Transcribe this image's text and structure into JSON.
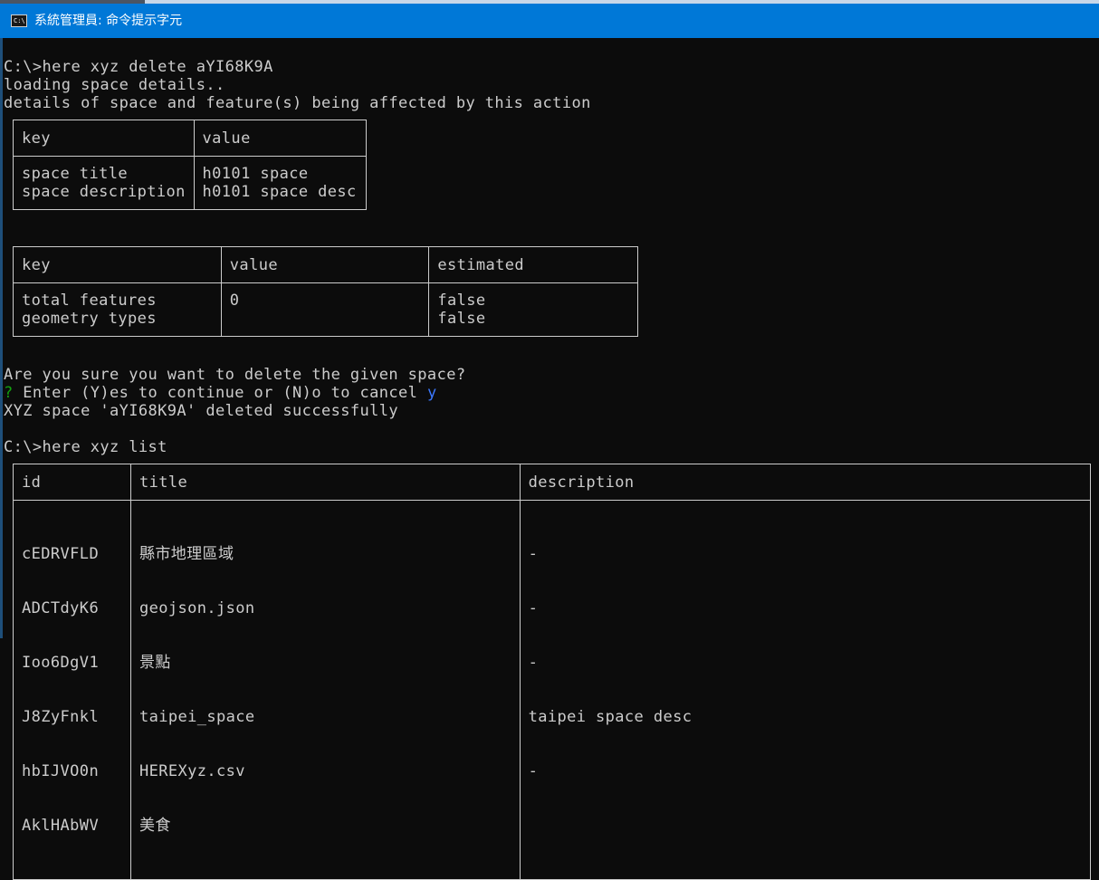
{
  "window": {
    "title": "系統管理員: 命令提示字元",
    "icon": "cmd-icon",
    "icon_text": "C:\\"
  },
  "colors": {
    "background": "#0c0c0c",
    "text": "#cccccc",
    "titlebar": "#0078d7",
    "prompt_mark": "#13a10e",
    "answer": "#3b78ff"
  },
  "console": {
    "cmd_delete": "C:\\>here xyz delete aYI68K9A",
    "loading": "loading space details..",
    "details_intro": "details of space and feature(s) being affected by this action",
    "confirm_question": "Are you sure you want to delete the given space?",
    "prompt_mark": "?",
    "prompt_text": " Enter (Y)es to continue or (N)o to cancel ",
    "prompt_answer": "y",
    "deleted_msg": "XYZ space 'aYI68K9A' deleted successfully",
    "cmd_list": "C:\\>here xyz list"
  },
  "space_table": {
    "headers": [
      "key",
      "value"
    ],
    "rows": [
      {
        "key": "space title",
        "value": "h0101 space"
      },
      {
        "key": "space description",
        "value": "h0101 space desc"
      }
    ]
  },
  "feature_table": {
    "headers": [
      "key",
      "value",
      "estimated"
    ],
    "rows": [
      {
        "key": "total features",
        "value": "0",
        "estimated": "false"
      },
      {
        "key": "geometry types",
        "value": "",
        "estimated": "false"
      }
    ]
  },
  "list_table": {
    "headers": [
      "id",
      "title",
      "description"
    ],
    "rows": [
      {
        "id": "cEDRVFLD",
        "title": "縣市地理區域",
        "description": "-"
      },
      {
        "id": "ADCTdyK6",
        "title": "geojson.json",
        "description": "-"
      },
      {
        "id": "Ioo6DgV1",
        "title": "景點",
        "description": "-"
      },
      {
        "id": "J8ZyFnkl",
        "title": "taipei_space",
        "description": "taipei space desc"
      },
      {
        "id": "hbIJVO0n",
        "title": "HEREXyz.csv",
        "description": "-"
      },
      {
        "id": "AklHAbWV",
        "title": "美食",
        "description": ""
      }
    ]
  }
}
